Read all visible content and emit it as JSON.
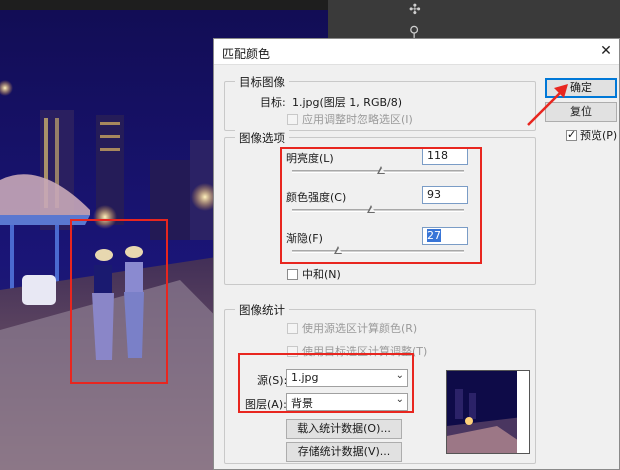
{
  "dialog": {
    "title": "匹配颜色",
    "close_icon": "close-icon",
    "target_section": {
      "legend": "目标图像",
      "target_label": "目标:",
      "target_value": "1.jpg(图层 1, RGB/8)",
      "ignore_selection_label": "应用调整时忽略选区(I)",
      "ignore_selection_checked": false
    },
    "image_options": {
      "legend": "图像选项",
      "brightness": {
        "label": "明亮度(L)",
        "value": "118",
        "slider_fraction": 0.52
      },
      "color_intensity": {
        "label": "颜色强度(C)",
        "value": "93",
        "slider_fraction": 0.46
      },
      "fade": {
        "label": "渐隐(F)",
        "value": "27",
        "slider_fraction": 0.27
      },
      "neutralize_label": "中和(N)",
      "neutralize_checked": false
    },
    "image_statistics": {
      "legend": "图像统计",
      "use_source_selection_label": "使用源选区计算颜色(R)",
      "use_target_selection_label": "使用目标选区计算调整(T)",
      "source_label": "源(S):",
      "source_value": "1.jpg",
      "layer_label": "图层(A):",
      "layer_value": "背景",
      "load_stats_label": "载入统计数据(O)...",
      "save_stats_label": "存储统计数据(V)..."
    },
    "buttons": {
      "ok_label": "确定",
      "reset_label": "复位",
      "preview_label": "预览(P)",
      "preview_checked": true
    }
  },
  "colors": {
    "annotation_red": "#e8261f",
    "focus_blue": "#0078d7",
    "selection_blue": "#3875d7"
  }
}
